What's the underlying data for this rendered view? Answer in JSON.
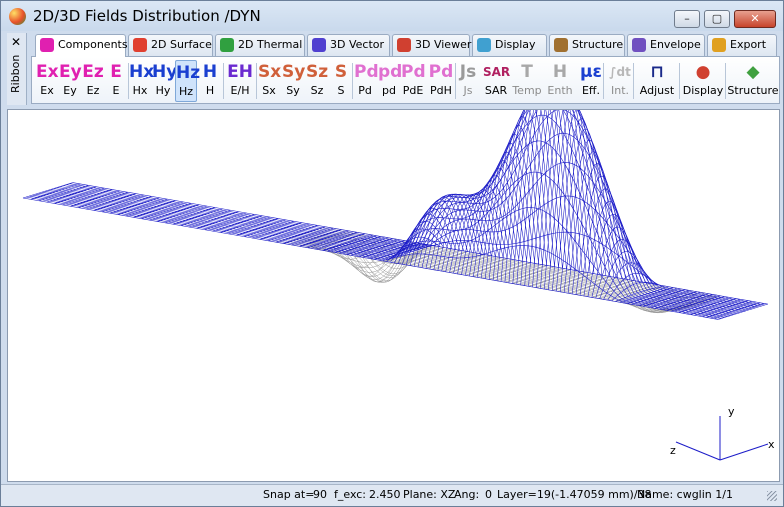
{
  "window": {
    "title": "2D/3D Fields Distribution /DYN",
    "minimize_label": "–",
    "maximize_label": "▢",
    "close_label": "✕"
  },
  "ribbon": {
    "close_label": "✕",
    "side_label": "Ribbon"
  },
  "tabs": [
    {
      "label": "Components",
      "active": true
    },
    {
      "label": "2D Surface"
    },
    {
      "label": "2D Thermal"
    },
    {
      "label": "3D Vector"
    },
    {
      "label": "3D Viewer"
    },
    {
      "label": "Display"
    },
    {
      "label": "Structure"
    },
    {
      "label": "Envelope"
    },
    {
      "label": "Export"
    }
  ],
  "tools": [
    {
      "label": "Ex",
      "glyph": "Ex",
      "color": "#e020b0"
    },
    {
      "label": "Ey",
      "glyph": "Ey",
      "color": "#e020b0"
    },
    {
      "label": "Ez",
      "glyph": "Ez",
      "color": "#e020b0"
    },
    {
      "label": "E",
      "glyph": "E",
      "color": "#e020b0"
    },
    {
      "label": "Hx",
      "glyph": "Hx",
      "color": "#1a3fd0"
    },
    {
      "label": "Hy",
      "glyph": "Hy",
      "color": "#1a3fd0"
    },
    {
      "label": "Hz",
      "glyph": "Hz",
      "color": "#1a3fd0",
      "selected": true
    },
    {
      "label": "H",
      "glyph": "H",
      "color": "#1a3fd0"
    },
    {
      "label": "E/H",
      "glyph": "EH",
      "color": "#6a2ad0"
    },
    {
      "label": "Sx",
      "glyph": "Sx",
      "color": "#d0603a"
    },
    {
      "label": "Sy",
      "glyph": "Sy",
      "color": "#d0603a"
    },
    {
      "label": "Sz",
      "glyph": "Sz",
      "color": "#d0603a"
    },
    {
      "label": "S",
      "glyph": "S",
      "color": "#d0603a"
    },
    {
      "label": "Pd",
      "glyph": "Pd",
      "color": "#e070d0"
    },
    {
      "label": "pd",
      "glyph": "pd",
      "color": "#e070d0"
    },
    {
      "label": "PdE",
      "glyph": "Pd",
      "color": "#e070d0"
    },
    {
      "label": "PdH",
      "glyph": "Pd",
      "color": "#e070d0"
    },
    {
      "label": "Js",
      "glyph": "Js",
      "color": "#9a9a9a",
      "disabled": true
    },
    {
      "label": "SAR",
      "glyph": "SAR",
      "color": "#b02060"
    },
    {
      "label": "Temp",
      "glyph": "T",
      "color": "#a8a8a8",
      "disabled": true
    },
    {
      "label": "Enth",
      "glyph": "H",
      "color": "#a8a8a8",
      "disabled": true
    },
    {
      "label": "Eff.",
      "glyph": "με",
      "color": "#1a3fd0"
    },
    {
      "label": "Int.",
      "glyph": "∫dt",
      "color": "#b8b8b8",
      "disabled": true
    },
    {
      "label": "Adjust",
      "glyph": "⊓",
      "color": "#1a2a8a"
    },
    {
      "label": "Display",
      "glyph": "●",
      "color": "#d04030"
    },
    {
      "label": "Structure",
      "glyph": "◆",
      "color": "#40a040"
    }
  ],
  "axes": {
    "x": "x",
    "y": "y",
    "z": "z"
  },
  "status": {
    "snap_label": "Snap at=",
    "snap_value": "90",
    "fexc_label": "f_exc:",
    "fexc_value": "2.450",
    "plane_label": "Plane: XZ",
    "ang_label": "Ang:",
    "ang_value": "0",
    "layer": "Layer=19(-1.47059 mm)/38",
    "name": "Name: cwglin 1/1"
  },
  "colors": {
    "mesh_main": "#1c1cc8",
    "mesh_back": "#9a9a9a"
  }
}
